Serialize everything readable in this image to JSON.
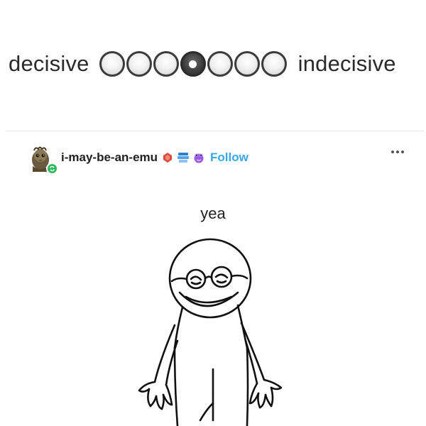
{
  "scale": {
    "left_label": "decisive",
    "right_label": "indecisive",
    "option_count": 7,
    "selected_index": 3
  },
  "post": {
    "username": "i-may-be-an-emu",
    "follow_label": "Follow",
    "body_text": "yea",
    "badges": [
      "red-gem-badge-icon",
      "stack-badge-icon",
      "purple-frog-badge-icon"
    ]
  },
  "colors": {
    "follow": "#3aa8e8",
    "reblog_badge": "#2fb85d",
    "badge_red": "#d94a3a",
    "badge_blue": "#2f7fd0",
    "badge_purple": "#9b59e0"
  }
}
